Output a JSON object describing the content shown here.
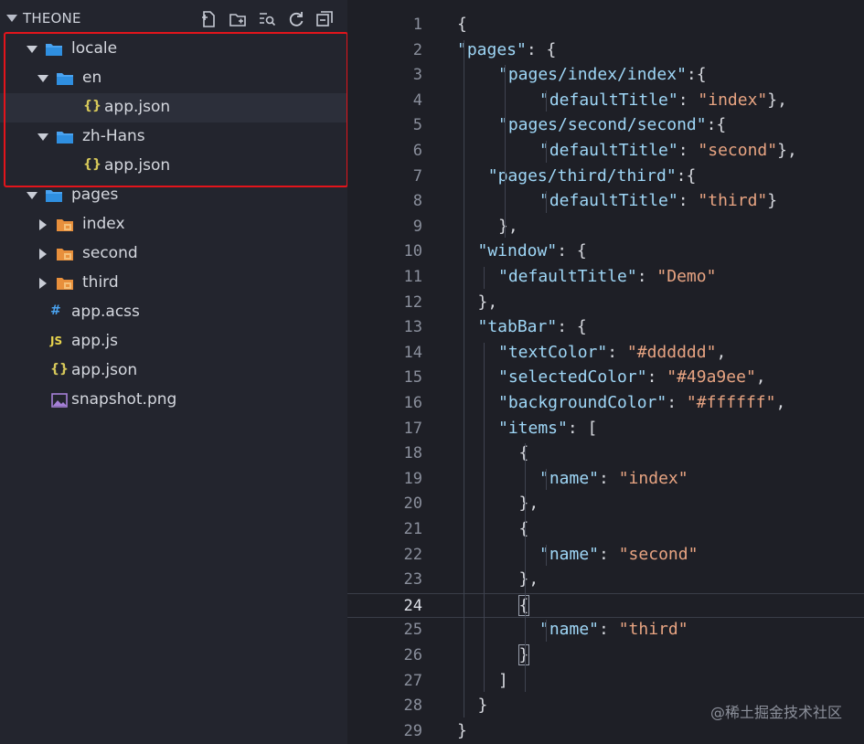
{
  "explorer": {
    "title": "THEONE",
    "toolbar_icons": [
      "new-file-icon",
      "new-folder-icon",
      "search-file-icon",
      "refresh-icon",
      "collapse-all-icon"
    ],
    "tree": [
      {
        "label": "locale",
        "kind": "folder",
        "state": "expanded",
        "depth": 1,
        "icon": "folder-open-icon"
      },
      {
        "label": "en",
        "kind": "folder",
        "state": "expanded",
        "depth": 2,
        "icon": "folder-open-icon"
      },
      {
        "label": "app.json",
        "kind": "file",
        "depth": 3,
        "icon": "json-file-icon",
        "icon_text": "{}",
        "selected": true
      },
      {
        "label": "zh-Hans",
        "kind": "folder",
        "state": "expanded",
        "depth": 2,
        "icon": "folder-open-icon"
      },
      {
        "label": "app.json",
        "kind": "file",
        "depth": 3,
        "icon": "json-file-icon",
        "icon_text": "{}"
      },
      {
        "label": "pages",
        "kind": "folder",
        "state": "expanded",
        "depth": 1,
        "icon": "folder-open-icon"
      },
      {
        "label": "index",
        "kind": "folder",
        "state": "collapsed",
        "depth": 2,
        "icon": "page-folder-icon"
      },
      {
        "label": "second",
        "kind": "folder",
        "state": "collapsed",
        "depth": 2,
        "icon": "page-folder-icon"
      },
      {
        "label": "third",
        "kind": "folder",
        "state": "collapsed",
        "depth": 2,
        "icon": "page-folder-icon"
      },
      {
        "label": "app.acss",
        "kind": "file",
        "depth": 1,
        "icon": "css-file-icon",
        "icon_text": "#"
      },
      {
        "label": "app.js",
        "kind": "file",
        "depth": 1,
        "icon": "js-file-icon",
        "icon_text": "JS"
      },
      {
        "label": "app.json",
        "kind": "file",
        "depth": 1,
        "icon": "json-file-icon",
        "icon_text": "{}"
      },
      {
        "label": "snapshot.png",
        "kind": "file",
        "depth": 1,
        "icon": "image-file-icon"
      }
    ]
  },
  "editor": {
    "active_line": 24,
    "lines": [
      {
        "n": "1",
        "indent": 0,
        "tokens": [
          [
            "p",
            "{"
          ]
        ]
      },
      {
        "n": "2",
        "indent": 0,
        "tokens": [
          [
            "k",
            "\"pages\""
          ],
          [
            "p",
            ": {"
          ]
        ]
      },
      {
        "n": "3",
        "indent": 2,
        "tokens": [
          [
            "k",
            "\"pages/index/index\""
          ],
          [
            "p",
            ":{"
          ]
        ]
      },
      {
        "n": "4",
        "indent": 4,
        "tokens": [
          [
            "k",
            "\"defaultTitle\""
          ],
          [
            "p",
            ": "
          ],
          [
            "s",
            "\"index\""
          ],
          [
            "p",
            "},"
          ]
        ]
      },
      {
        "n": "5",
        "indent": 2,
        "tokens": [
          [
            "k",
            "\"pages/second/second\""
          ],
          [
            "p",
            ":{"
          ]
        ]
      },
      {
        "n": "6",
        "indent": 4,
        "tokens": [
          [
            "k",
            "\"defaultTitle\""
          ],
          [
            "p",
            ": "
          ],
          [
            "s",
            "\"second\""
          ],
          [
            "p",
            "},"
          ]
        ]
      },
      {
        "n": "7",
        "indent": 1.5,
        "tokens": [
          [
            "k",
            "\"pages/third/third\""
          ],
          [
            "p",
            ":{"
          ]
        ]
      },
      {
        "n": "8",
        "indent": 4,
        "tokens": [
          [
            "k",
            "\"defaultTitle\""
          ],
          [
            "p",
            ": "
          ],
          [
            "s",
            "\"third\""
          ],
          [
            "p",
            "}"
          ]
        ]
      },
      {
        "n": "9",
        "indent": 2,
        "tokens": [
          [
            "p",
            "},"
          ]
        ]
      },
      {
        "n": "10",
        "indent": 1,
        "tokens": [
          [
            "k",
            "\"window\""
          ],
          [
            "p",
            ": {"
          ]
        ]
      },
      {
        "n": "11",
        "indent": 2,
        "tokens": [
          [
            "k",
            "\"defaultTitle\""
          ],
          [
            "p",
            ": "
          ],
          [
            "s",
            "\"Demo\""
          ]
        ]
      },
      {
        "n": "12",
        "indent": 1,
        "tokens": [
          [
            "p",
            "},"
          ]
        ]
      },
      {
        "n": "13",
        "indent": 1,
        "tokens": [
          [
            "k",
            "\"tabBar\""
          ],
          [
            "p",
            ": {"
          ]
        ]
      },
      {
        "n": "14",
        "indent": 2,
        "tokens": [
          [
            "k",
            "\"textColor\""
          ],
          [
            "p",
            ": "
          ],
          [
            "s",
            "\"#dddddd\""
          ],
          [
            "p",
            ","
          ]
        ]
      },
      {
        "n": "15",
        "indent": 2,
        "tokens": [
          [
            "k",
            "\"selectedColor\""
          ],
          [
            "p",
            ": "
          ],
          [
            "s",
            "\"#49a9ee\""
          ],
          [
            "p",
            ","
          ]
        ]
      },
      {
        "n": "16",
        "indent": 2,
        "tokens": [
          [
            "k",
            "\"backgroundColor\""
          ],
          [
            "p",
            ": "
          ],
          [
            "s",
            "\"#ffffff\""
          ],
          [
            "p",
            ","
          ]
        ]
      },
      {
        "n": "17",
        "indent": 2,
        "tokens": [
          [
            "k",
            "\"items\""
          ],
          [
            "p",
            ": ["
          ]
        ]
      },
      {
        "n": "18",
        "indent": 3,
        "tokens": [
          [
            "p",
            "{"
          ]
        ]
      },
      {
        "n": "19",
        "indent": 4,
        "tokens": [
          [
            "k",
            "\"name\""
          ],
          [
            "p",
            ": "
          ],
          [
            "s",
            "\"index\""
          ]
        ]
      },
      {
        "n": "20",
        "indent": 3,
        "tokens": [
          [
            "p",
            "},"
          ]
        ]
      },
      {
        "n": "21",
        "indent": 3,
        "tokens": [
          [
            "p",
            "{"
          ]
        ]
      },
      {
        "n": "22",
        "indent": 4,
        "tokens": [
          [
            "k",
            "\"name\""
          ],
          [
            "p",
            ": "
          ],
          [
            "s",
            "\"second\""
          ]
        ]
      },
      {
        "n": "23",
        "indent": 3,
        "tokens": [
          [
            "p",
            "},"
          ]
        ]
      },
      {
        "n": "24",
        "indent": 3,
        "tokens": [
          [
            "b",
            "{"
          ]
        ]
      },
      {
        "n": "25",
        "indent": 4,
        "tokens": [
          [
            "k",
            "\"name\""
          ],
          [
            "p",
            ": "
          ],
          [
            "s",
            "\"third\""
          ]
        ]
      },
      {
        "n": "26",
        "indent": 3,
        "tokens": [
          [
            "b",
            "}"
          ]
        ]
      },
      {
        "n": "27",
        "indent": 2,
        "tokens": [
          [
            "p",
            "]"
          ]
        ]
      },
      {
        "n": "28",
        "indent": 1,
        "tokens": [
          [
            "p",
            "}"
          ]
        ]
      },
      {
        "n": "29",
        "indent": 0,
        "tokens": [
          [
            "p",
            "}"
          ]
        ]
      }
    ]
  },
  "watermark": "@稀土掘金技术社区",
  "colors": {
    "folder": "#4aa3f0",
    "page_folder": "#e8903c",
    "json": "#d6c85a",
    "css": "#4aa3f0",
    "js": "#e8d44d",
    "highlight": "#e3141b"
  }
}
